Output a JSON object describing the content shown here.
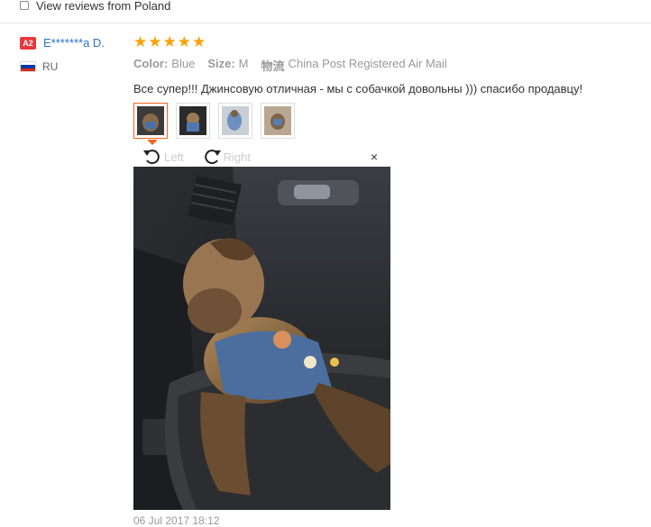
{
  "filter": {
    "label": "View reviews from Poland",
    "checked": false
  },
  "buyer": {
    "level": "A2",
    "name": "E*******a D.",
    "country": "RU",
    "flag_colors": [
      "#ffffff",
      "#0039a6",
      "#d52b1e"
    ]
  },
  "review": {
    "stars": 5,
    "star_color": "#f7a30a",
    "meta": {
      "color_label": "Color:",
      "color_value": "Blue",
      "size_label": "Size:",
      "size_value": "M",
      "shipping_label": "物流",
      "shipping_value": "China Post Registered Air Mail"
    },
    "text": "Все супер!!! Джинсовую отличная - мы с собачкой довольны ))) спасибо продавцу!"
  },
  "thumbnails": [
    {
      "name": "review-photo-1",
      "active": true
    },
    {
      "name": "review-photo-2",
      "active": false
    },
    {
      "name": "review-photo-3",
      "active": false
    },
    {
      "name": "review-photo-4",
      "active": false
    }
  ],
  "viewer": {
    "rotate_left_label": "Left",
    "rotate_right_label": "Right",
    "close_symbol": "×"
  },
  "date": "06 Jul 2017 18:12",
  "accent_color": "#f26522",
  "link_color": "#2a6fc9"
}
